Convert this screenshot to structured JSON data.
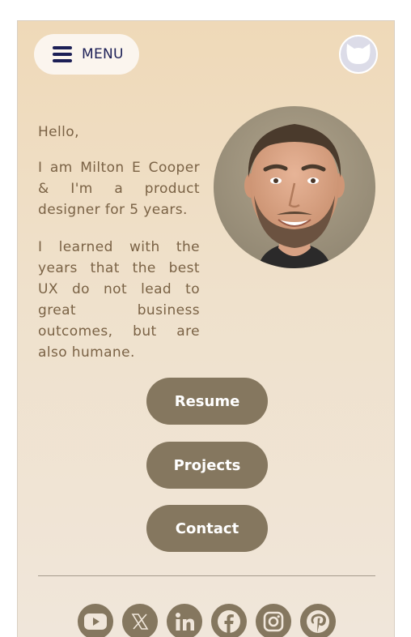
{
  "header": {
    "menu_label": "MENU",
    "menu_icon": "hamburger-icon",
    "profile_icon": "cat-icon"
  },
  "intro": {
    "greeting": "Hello,",
    "paragraph1": "I am Milton E Cooper & I'm a product designer for 5 years.",
    "paragraph2": "I learned with the years that the best UX do not lead to great business outcomes, but are also humane."
  },
  "buttons": {
    "resume": "Resume",
    "projects": "Projects",
    "contact": "Contact"
  },
  "social": [
    "youtube-icon",
    "x-icon",
    "linkedin-icon",
    "facebook-icon",
    "instagram-icon",
    "pinterest-icon"
  ],
  "colors": {
    "accent": "#85775f",
    "text": "#7a6245",
    "menu_text": "#1c1f56",
    "background_top": "#efd9b8",
    "background_bottom": "#f0e6da"
  }
}
